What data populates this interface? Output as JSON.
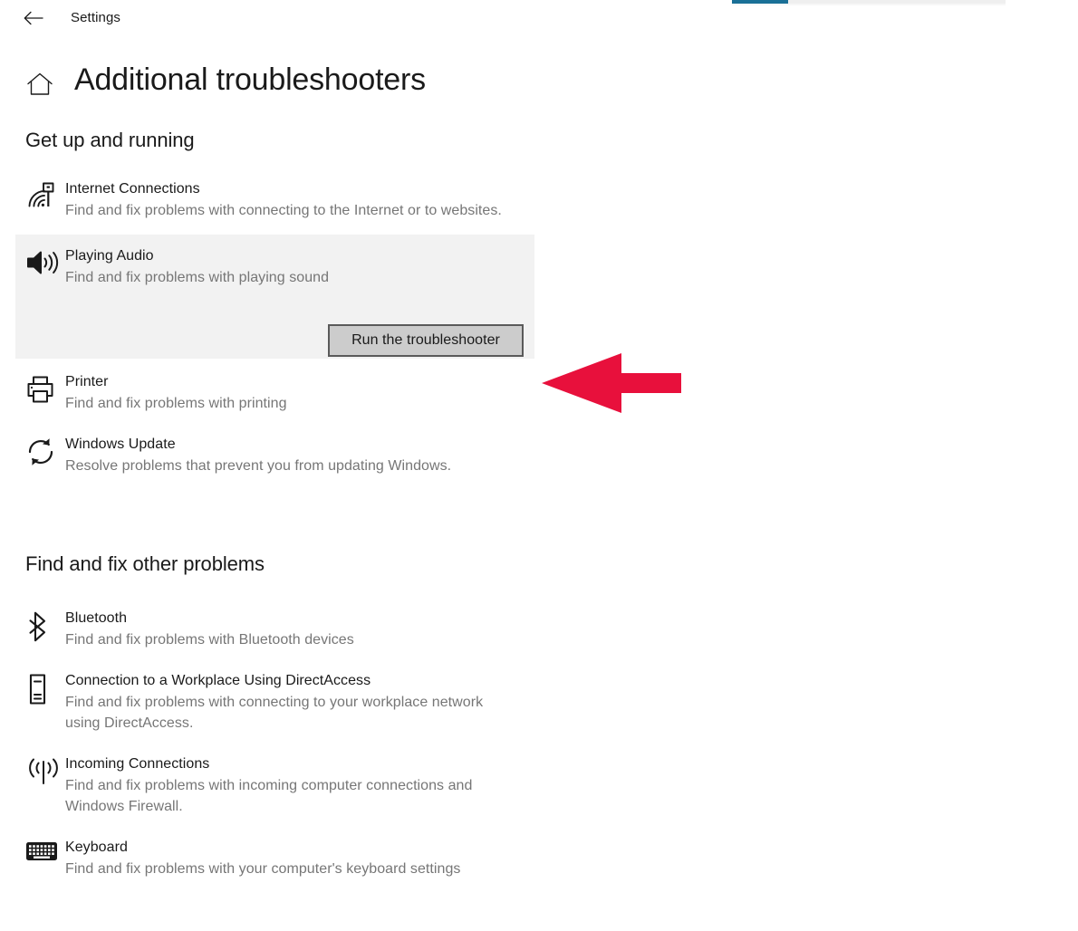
{
  "window": {
    "app_title": "Settings",
    "back_icon": "back-arrow-icon",
    "home_icon": "home-icon",
    "page_title": "Additional troubleshooters"
  },
  "progress": {
    "accent_color": "#1a7097",
    "track_color": "#efefef"
  },
  "sections": [
    {
      "heading": "Get up and running",
      "items": [
        {
          "icon": "internet-connections-icon",
          "title": "Internet Connections",
          "desc": "Find and fix problems with connecting to the Internet or to websites.",
          "selected": false
        },
        {
          "icon": "playing-audio-icon",
          "title": "Playing Audio",
          "desc": "Find and fix problems with playing sound",
          "selected": true,
          "button_label": "Run the troubleshooter"
        },
        {
          "icon": "printer-icon",
          "title": "Printer",
          "desc": "Find and fix problems with printing",
          "selected": false
        },
        {
          "icon": "windows-update-icon",
          "title": "Windows Update",
          "desc": "Resolve problems that prevent you from updating Windows.",
          "selected": false
        }
      ]
    },
    {
      "heading": "Find and fix other problems",
      "items": [
        {
          "icon": "bluetooth-icon",
          "title": "Bluetooth",
          "desc": "Find and fix problems with Bluetooth devices",
          "selected": false
        },
        {
          "icon": "directaccess-icon",
          "title": "Connection to a Workplace Using DirectAccess",
          "desc": "Find and fix problems with connecting to your workplace network using DirectAccess.",
          "selected": false
        },
        {
          "icon": "incoming-connections-icon",
          "title": "Incoming Connections",
          "desc": "Find and fix problems with incoming computer connections and Windows Firewall.",
          "selected": false
        },
        {
          "icon": "keyboard-icon",
          "title": "Keyboard",
          "desc": "Find and fix problems with your computer's keyboard settings",
          "selected": false
        }
      ]
    }
  ],
  "annotation": {
    "type": "arrow-left",
    "color": "#e8103c",
    "points_to": "Run the troubleshooter"
  }
}
